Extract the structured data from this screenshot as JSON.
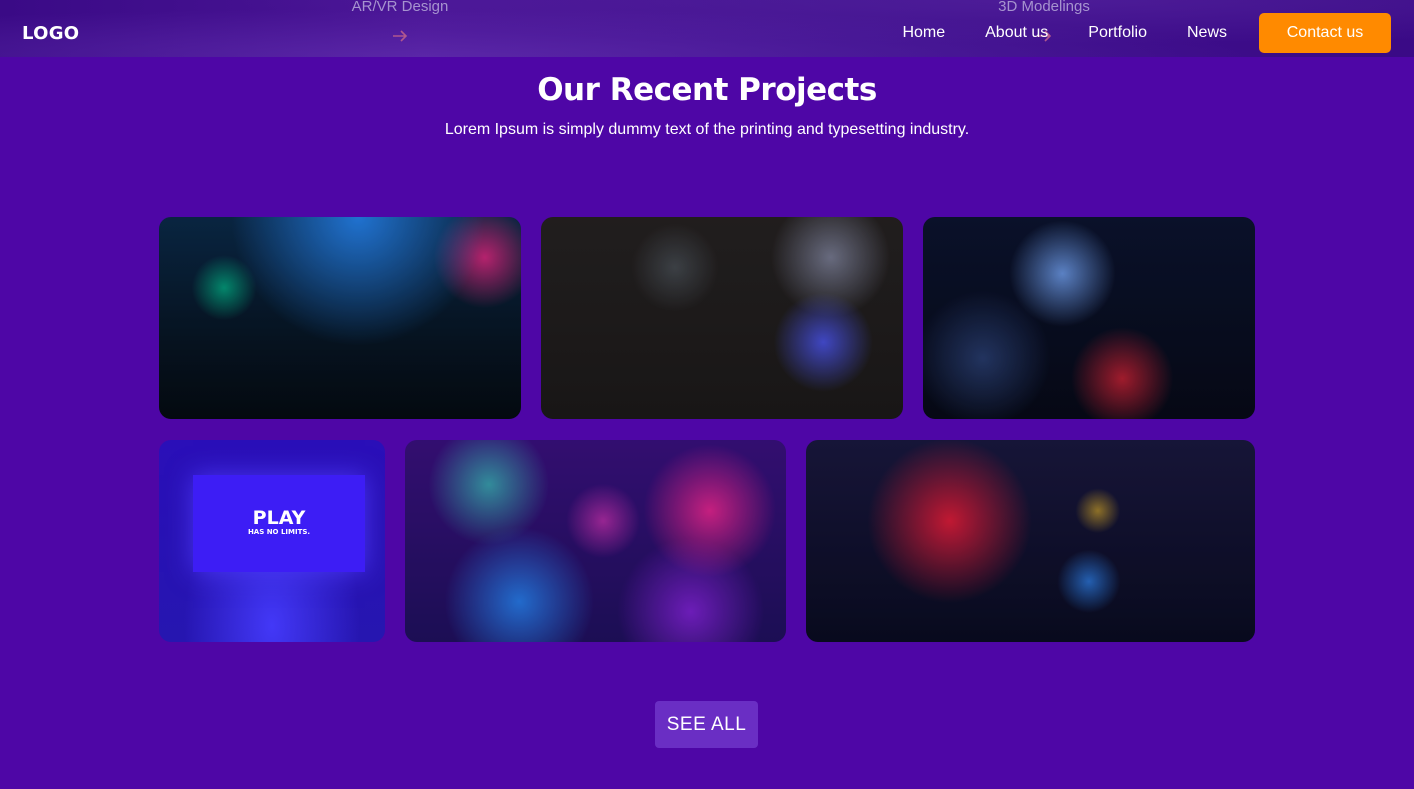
{
  "header": {
    "logo": "LOGO",
    "ghost_services": [
      {
        "label": "AR/VR Design",
        "icon": "arrow-right-icon"
      },
      {
        "label": "3D Modelings",
        "icon": "arrow-right-icon"
      }
    ],
    "nav": [
      {
        "label": "Home"
      },
      {
        "label": "About us"
      },
      {
        "label": "Portfolio"
      },
      {
        "label": "News"
      }
    ],
    "contact_label": "Contact us"
  },
  "projects": {
    "title": "Our Recent Projects",
    "subtitle": "Lorem Ipsum is simply dummy text of the printing and typesetting industry.",
    "items": [
      {
        "name": "neon-arcade-room-photo"
      },
      {
        "name": "gamer-at-monitor-photo"
      },
      {
        "name": "pc-water-cooling-photo"
      },
      {
        "name": "play-screen-photo",
        "screen_title": "PLAY",
        "screen_tagline": "HAS NO LIMITS."
      },
      {
        "name": "claw-machine-arcade-photo"
      },
      {
        "name": "red-arcade-cabinet-photo"
      }
    ],
    "see_all_label": "SEE ALL"
  },
  "colors": {
    "background": "#4e06a6",
    "accent": "#ff8a00",
    "button": "#6a2ec4",
    "text": "#ffffff"
  }
}
